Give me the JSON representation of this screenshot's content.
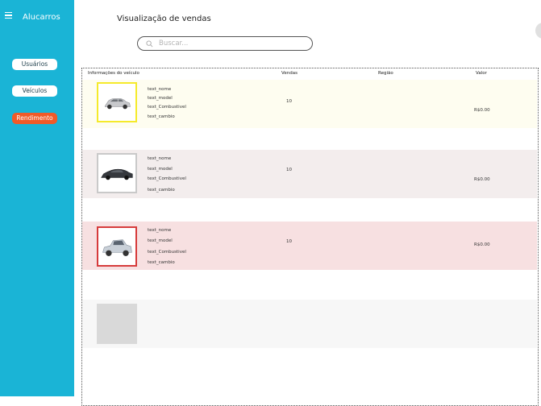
{
  "sidebar": {
    "brand": "Alucarros",
    "nav": [
      {
        "label": "Usuários"
      },
      {
        "label": "Veículos"
      },
      {
        "label": "Rendimento"
      }
    ]
  },
  "header": {
    "title": "Visualização de vendas",
    "search_placeholder": "Buscar..."
  },
  "table": {
    "headers": [
      "Informações do veículo",
      "Vendas",
      "Região",
      "Valor"
    ],
    "rows": [
      {
        "nome": "text_nome",
        "model": "text_model",
        "combustivel": "text_Combustivel",
        "cambio": "text_cambio",
        "vendas": "10",
        "valor": "R$0.00"
      },
      {
        "nome": "text_nome",
        "model": "text_model",
        "combustivel": "text_Combustivel",
        "cambio": "text_cambio",
        "vendas": "10",
        "valor": "R$0.00"
      },
      {
        "nome": "text_nome",
        "model": "text_model",
        "combustivel": "text_Combustivel",
        "cambio": "text_cambio",
        "vendas": "10",
        "valor": "R$0.00"
      }
    ]
  },
  "colors": {
    "sidebar": "#1ab4d6",
    "active_nav": "#f05a28",
    "row1_bg": "#fefdf0",
    "row2_bg": "#f3eded",
    "row3_bg": "#f7e0e1",
    "row4_bg": "#f7f7f7"
  }
}
